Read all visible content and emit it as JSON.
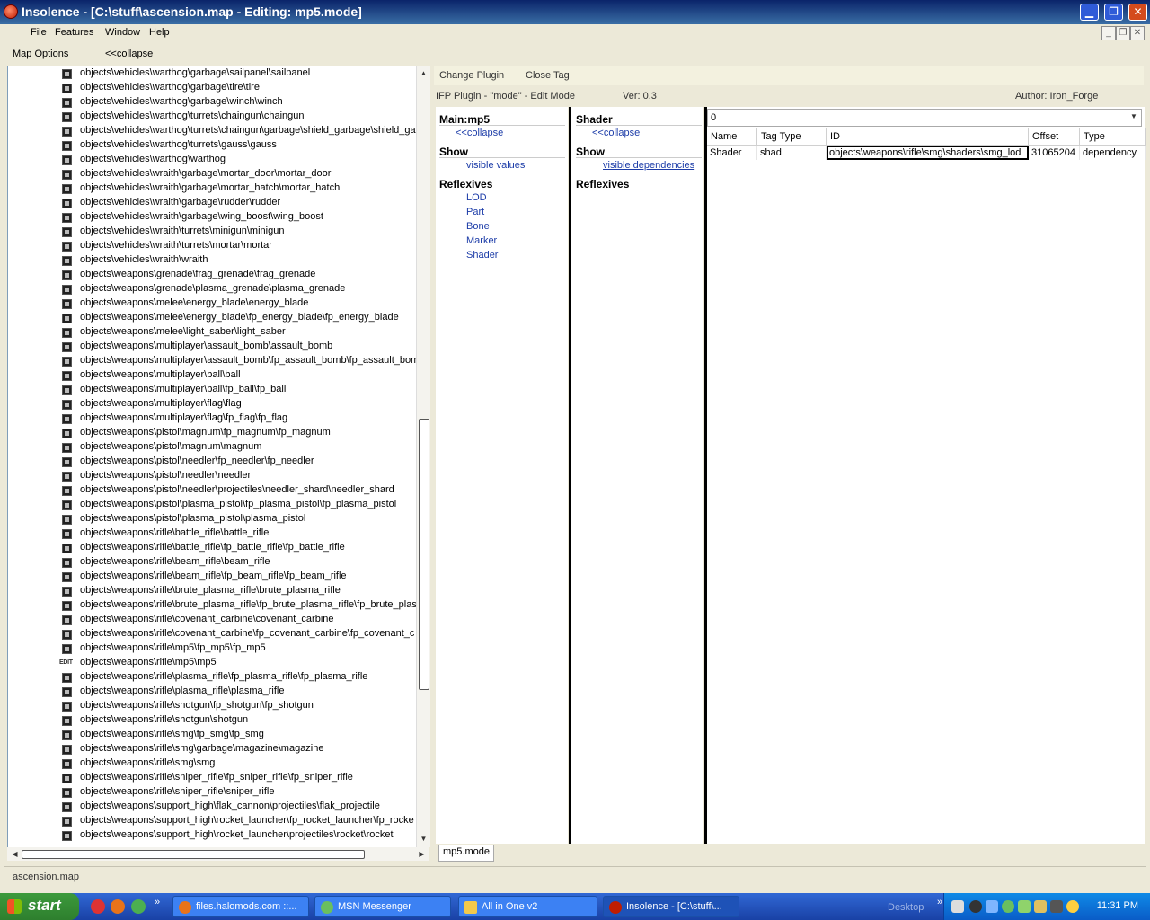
{
  "window": {
    "title": "Insolence - [C:\\stuff\\ascension.map - Editing: mp5.mode]",
    "min": "▁",
    "restore": "❐",
    "close": "✕"
  },
  "menu": {
    "file": "File",
    "features": "Features",
    "window": "Window",
    "help": "Help"
  },
  "left_toolbar": {
    "map_options": "Map Options",
    "collapse": "<<collapse"
  },
  "tree": {
    "items": [
      "objects\\vehicles\\warthog\\garbage\\sailpanel\\sailpanel",
      "objects\\vehicles\\warthog\\garbage\\tire\\tire",
      "objects\\vehicles\\warthog\\garbage\\winch\\winch",
      "objects\\vehicles\\warthog\\turrets\\chaingun\\chaingun",
      "objects\\vehicles\\warthog\\turrets\\chaingun\\garbage\\shield_garbage\\shield_ga",
      "objects\\vehicles\\warthog\\turrets\\gauss\\gauss",
      "objects\\vehicles\\warthog\\warthog",
      "objects\\vehicles\\wraith\\garbage\\mortar_door\\mortar_door",
      "objects\\vehicles\\wraith\\garbage\\mortar_hatch\\mortar_hatch",
      "objects\\vehicles\\wraith\\garbage\\rudder\\rudder",
      "objects\\vehicles\\wraith\\garbage\\wing_boost\\wing_boost",
      "objects\\vehicles\\wraith\\turrets\\minigun\\minigun",
      "objects\\vehicles\\wraith\\turrets\\mortar\\mortar",
      "objects\\vehicles\\wraith\\wraith",
      "objects\\weapons\\grenade\\frag_grenade\\frag_grenade",
      "objects\\weapons\\grenade\\plasma_grenade\\plasma_grenade",
      "objects\\weapons\\melee\\energy_blade\\energy_blade",
      "objects\\weapons\\melee\\energy_blade\\fp_energy_blade\\fp_energy_blade",
      "objects\\weapons\\melee\\light_saber\\light_saber",
      "objects\\weapons\\multiplayer\\assault_bomb\\assault_bomb",
      "objects\\weapons\\multiplayer\\assault_bomb\\fp_assault_bomb\\fp_assault_bomb",
      "objects\\weapons\\multiplayer\\ball\\ball",
      "objects\\weapons\\multiplayer\\ball\\fp_ball\\fp_ball",
      "objects\\weapons\\multiplayer\\flag\\flag",
      "objects\\weapons\\multiplayer\\flag\\fp_flag\\fp_flag",
      "objects\\weapons\\pistol\\magnum\\fp_magnum\\fp_magnum",
      "objects\\weapons\\pistol\\magnum\\magnum",
      "objects\\weapons\\pistol\\needler\\fp_needler\\fp_needler",
      "objects\\weapons\\pistol\\needler\\needler",
      "objects\\weapons\\pistol\\needler\\projectiles\\needler_shard\\needler_shard",
      "objects\\weapons\\pistol\\plasma_pistol\\fp_plasma_pistol\\fp_plasma_pistol",
      "objects\\weapons\\pistol\\plasma_pistol\\plasma_pistol",
      "objects\\weapons\\rifle\\battle_rifle\\battle_rifle",
      "objects\\weapons\\rifle\\battle_rifle\\fp_battle_rifle\\fp_battle_rifle",
      "objects\\weapons\\rifle\\beam_rifle\\beam_rifle",
      "objects\\weapons\\rifle\\beam_rifle\\fp_beam_rifle\\fp_beam_rifle",
      "objects\\weapons\\rifle\\brute_plasma_rifle\\brute_plasma_rifle",
      "objects\\weapons\\rifle\\brute_plasma_rifle\\fp_brute_plasma_rifle\\fp_brute_plasm",
      "objects\\weapons\\rifle\\covenant_carbine\\covenant_carbine",
      "objects\\weapons\\rifle\\covenant_carbine\\fp_covenant_carbine\\fp_covenant_c",
      "objects\\weapons\\rifle\\mp5\\fp_mp5\\fp_mp5",
      "objects\\weapons\\rifle\\mp5\\mp5",
      "objects\\weapons\\rifle\\plasma_rifle\\fp_plasma_rifle\\fp_plasma_rifle",
      "objects\\weapons\\rifle\\plasma_rifle\\plasma_rifle",
      "objects\\weapons\\rifle\\shotgun\\fp_shotgun\\fp_shotgun",
      "objects\\weapons\\rifle\\shotgun\\shotgun",
      "objects\\weapons\\rifle\\smg\\fp_smg\\fp_smg",
      "objects\\weapons\\rifle\\smg\\garbage\\magazine\\magazine",
      "objects\\weapons\\rifle\\smg\\smg",
      "objects\\weapons\\rifle\\sniper_rifle\\fp_sniper_rifle\\fp_sniper_rifle",
      "objects\\weapons\\rifle\\sniper_rifle\\sniper_rifle",
      "objects\\weapons\\support_high\\flak_cannon\\projectiles\\flak_projectile",
      "objects\\weapons\\support_high\\rocket_launcher\\fp_rocket_launcher\\fp_rocke",
      "objects\\weapons\\support_high\\rocket_launcher\\projectiles\\rocket\\rocket"
    ],
    "editing_item_index": 41,
    "edit_icon_label": "EDIT"
  },
  "plugin_toolbar": {
    "change_plugin": "Change Plugin",
    "close_tag": "Close Tag"
  },
  "plugin_info": {
    "name": "IFP Plugin - \"mode\" - Edit Mode",
    "version": "Ver: 0.3",
    "author": "Author: Iron_Forge"
  },
  "column1": {
    "main_title": "Main:mp5",
    "collapse": "<<collapse",
    "show_title": "Show",
    "visible_values": "visible values",
    "reflexives_title": "Reflexives",
    "reflexives": [
      "LOD",
      "Part",
      "Bone",
      "Marker",
      "Shader"
    ]
  },
  "column2": {
    "title": "Shader",
    "collapse": "<<collapse",
    "show_title": "Show",
    "visible_dependencies": "visible dependencies",
    "reflexives_title": "Reflexives"
  },
  "tag_panel": {
    "combo_value": "0",
    "columns": [
      "Name",
      "Tag Type",
      "ID",
      "Offset",
      "Type"
    ],
    "rows": [
      [
        "Shader",
        "shad",
        "objects\\weapons\\rifle\\smg\\shaders\\smg_lod",
        "31065204",
        "dependency"
      ]
    ]
  },
  "doc_tab": "mp5.mode",
  "status": "ascension.map",
  "taskbar": {
    "start": "start",
    "tasks": [
      "files.halomods.com ::...",
      "MSN Messenger",
      "All in One v2",
      "Insolence - [C:\\stuff\\..."
    ],
    "desktop": "Desktop",
    "clock": "11:31 PM"
  }
}
